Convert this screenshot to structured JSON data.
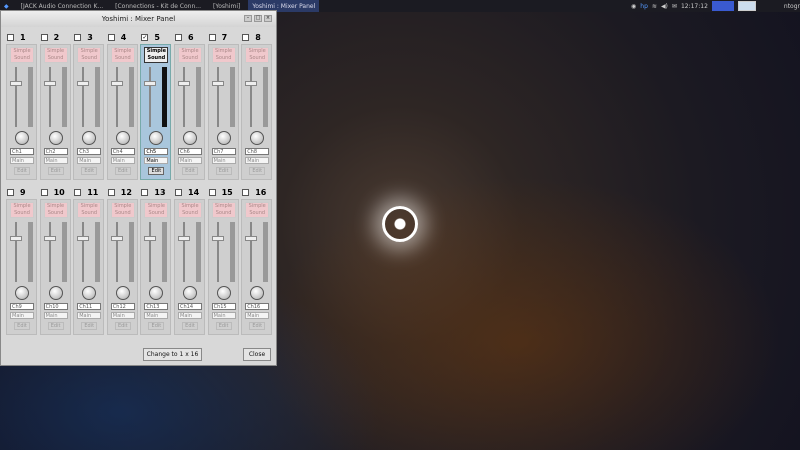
{
  "taskbar": {
    "tasks": [
      "[JACK Audio Connection K...",
      "[Connections - Kit de Conn...",
      "[Yoshimi]",
      "Yoshimi : Mixer Panel"
    ],
    "active_index": 3,
    "clock": "12:17:12",
    "user": "ntogr"
  },
  "window": {
    "title": "Yoshimi : Mixer Panel"
  },
  "strips": [
    {
      "num": "1",
      "name": "Simple Sound",
      "channel": "Ch1",
      "route": "Main",
      "edit": "Edit",
      "checked": false
    },
    {
      "num": "2",
      "name": "Simple Sound",
      "channel": "Ch2",
      "route": "Main",
      "edit": "Edit",
      "checked": false
    },
    {
      "num": "3",
      "name": "Simple Sound",
      "channel": "Ch3",
      "route": "Main",
      "edit": "Edit",
      "checked": false
    },
    {
      "num": "4",
      "name": "Simple Sound",
      "channel": "Ch4",
      "route": "Main",
      "edit": "Edit",
      "checked": false
    },
    {
      "num": "5",
      "name": "Simple Sound",
      "channel": "Ch5",
      "route": "Main",
      "edit": "Edit",
      "checked": true
    },
    {
      "num": "6",
      "name": "Simple Sound",
      "channel": "Ch6",
      "route": "Main",
      "edit": "Edit",
      "checked": false
    },
    {
      "num": "7",
      "name": "Simple Sound",
      "channel": "Ch7",
      "route": "Main",
      "edit": "Edit",
      "checked": false
    },
    {
      "num": "8",
      "name": "Simple Sound",
      "channel": "Ch8",
      "route": "Main",
      "edit": "Edit",
      "checked": false
    },
    {
      "num": "9",
      "name": "Simple Sound",
      "channel": "Ch9",
      "route": "Main",
      "edit": "Edit",
      "checked": false
    },
    {
      "num": "10",
      "name": "Simple Sound",
      "channel": "Ch10",
      "route": "Main",
      "edit": "Edit",
      "checked": false
    },
    {
      "num": "11",
      "name": "Simple Sound",
      "channel": "Ch11",
      "route": "Main",
      "edit": "Edit",
      "checked": false
    },
    {
      "num": "12",
      "name": "Simple Sound",
      "channel": "Ch12",
      "route": "Main",
      "edit": "Edit",
      "checked": false
    },
    {
      "num": "13",
      "name": "Simple Sound",
      "channel": "Ch13",
      "route": "Main",
      "edit": "Edit",
      "checked": false
    },
    {
      "num": "14",
      "name": "Simple Sound",
      "channel": "Ch14",
      "route": "Main",
      "edit": "Edit",
      "checked": false
    },
    {
      "num": "15",
      "name": "Simple Sound",
      "channel": "Ch15",
      "route": "Main",
      "edit": "Edit",
      "checked": false
    },
    {
      "num": "16",
      "name": "Simple Sound",
      "channel": "Ch16",
      "route": "Main",
      "edit": "Edit",
      "checked": false
    }
  ],
  "selected_strip": 5,
  "footer": {
    "change_label": "Change to 1 x 16",
    "close_label": "Close"
  }
}
